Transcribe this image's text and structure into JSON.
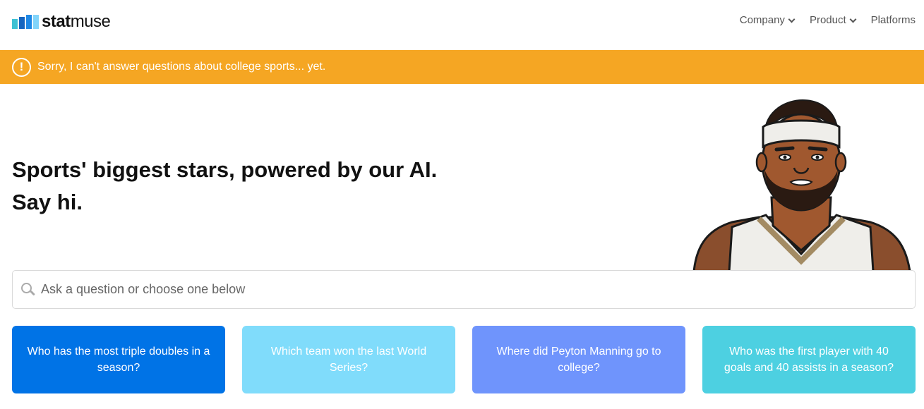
{
  "header": {
    "logo": {
      "bold": "stat",
      "regular": "muse",
      "bar_colors": [
        "#3ec1d3",
        "#1565c0",
        "#1e88e5",
        "#81d4fa"
      ]
    },
    "nav": [
      {
        "label": "Company",
        "has_dropdown": true
      },
      {
        "label": "Product",
        "has_dropdown": true
      },
      {
        "label": "Platforms",
        "has_dropdown": false
      }
    ]
  },
  "alert": {
    "icon": "exclamation-circle-icon",
    "text": "Sorry, I can't answer questions about college sports... yet.",
    "color": "#f5a623"
  },
  "hero": {
    "line1": "Sports' biggest stars, powered by our AI.",
    "line2": "Say hi."
  },
  "search": {
    "placeholder": "Ask a question or choose one below",
    "value": ""
  },
  "suggestions": [
    {
      "text": "Who has the most triple doubles in a season?",
      "color": "#0073e6"
    },
    {
      "text": "Which team won the last World Series?",
      "color": "#80dcfb"
    },
    {
      "text": "Where did Peyton Manning go to college?",
      "color": "#6f94fc"
    },
    {
      "text": "Who was the first player with 40 goals and 40 assists in a season?",
      "color": "#4dd0e1"
    }
  ]
}
